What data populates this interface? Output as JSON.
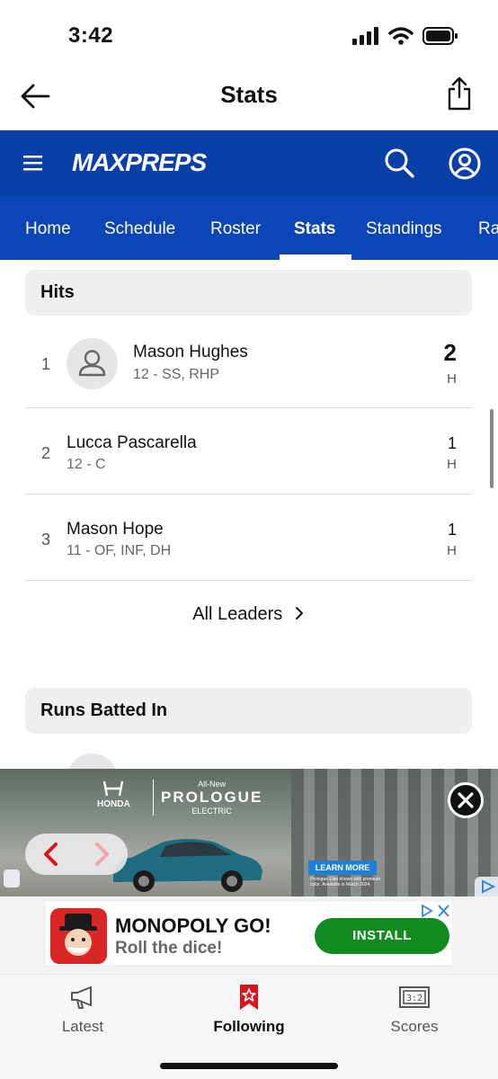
{
  "status_bar": {
    "time": "3:42"
  },
  "nav": {
    "title": "Stats"
  },
  "maxpreps": {
    "logo": "MAXPREPS"
  },
  "tabs": [
    {
      "label": "Home"
    },
    {
      "label": "Schedule"
    },
    {
      "label": "Roster"
    },
    {
      "label": "Stats",
      "active": true
    },
    {
      "label": "Standings"
    },
    {
      "label": "Ra"
    }
  ],
  "sections": [
    {
      "title": "Hits",
      "rows": [
        {
          "rank": "1",
          "name": "Mason Hughes",
          "info": "12 - SS, RHP",
          "value": "2",
          "unit": "H"
        },
        {
          "rank": "2",
          "name": "Lucca Pascarella",
          "info": "12 - C",
          "value": "1",
          "unit": "H"
        },
        {
          "rank": "3",
          "name": "Mason Hope",
          "info": "11 - OF, INF, DH",
          "value": "1",
          "unit": "H"
        }
      ],
      "all_leaders": "All Leaders"
    },
    {
      "title": "Runs Batted In"
    }
  ],
  "ads": {
    "banner": {
      "brand": "HONDA",
      "model_prefix": "All-New",
      "model": "PROLOGUE",
      "model_suffix": "ELECTRIC",
      "cta": "LEARN MORE",
      "fine_print": "Prologue Elite shown with premium color. Available in March 2024."
    },
    "app": {
      "title": "MONOPOLY GO!",
      "subtitle": "Roll the dice!",
      "cta": "INSTALL"
    }
  },
  "bottom_nav": [
    {
      "label": "Latest",
      "icon": "megaphone-icon"
    },
    {
      "label": "Following",
      "icon": "bookmark-star-icon",
      "active": true
    },
    {
      "label": "Scores",
      "icon": "scoreboard-icon"
    }
  ],
  "colors": {
    "brand_blue": "#0b3fa8",
    "tab_blue": "#0c46b6",
    "accent_red": "#d8141c",
    "install_green": "#118a1f"
  }
}
